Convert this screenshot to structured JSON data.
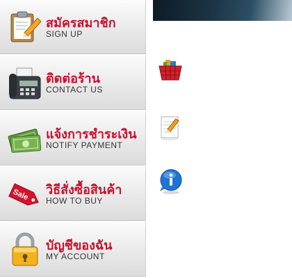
{
  "menu": {
    "items": [
      {
        "th": "สมัครสมาชิก",
        "en": "SIGN UP",
        "icon": "clipboard-pencil-icon"
      },
      {
        "th": "ติดต่อร้าน",
        "en": "CONTACT US",
        "icon": "fax-phone-icon"
      },
      {
        "th": "แจ้งการชำระเงิน",
        "en": "NOTIFY PAYMENT",
        "icon": "money-icon"
      },
      {
        "th": "วิธีสั่งซื้อสินค้า",
        "en": "HOW TO BUY",
        "icon": "sale-tag-icon"
      },
      {
        "th": "บัญชีของฉัน",
        "en": "MY ACCOUNT",
        "icon": "padlock-icon"
      }
    ]
  },
  "sale_tag": {
    "text": "Sale"
  },
  "side_icons": [
    "shopping-basket-icon",
    "note-pencil-icon",
    "info-bubble-icon"
  ],
  "colors": {
    "accent_red": "#c8102e",
    "topbar_dark": "#1d3647"
  }
}
